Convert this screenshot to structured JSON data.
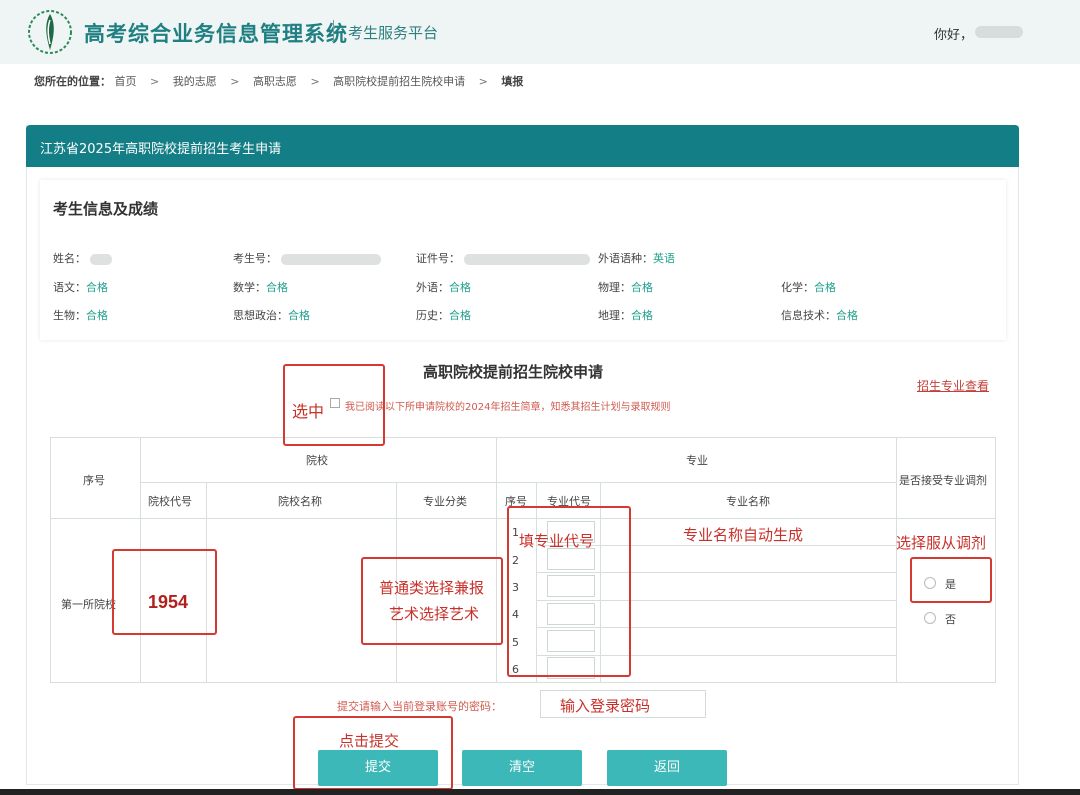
{
  "header": {
    "system_title": "高考综合业务信息管理系统",
    "platform": "考生服务平台",
    "greeting": "你好，"
  },
  "breadcrumb": {
    "prefix": "您所在的位置：",
    "items": [
      "首页",
      "我的志愿",
      "高职志愿",
      "高职院校提前招生院校申请"
    ],
    "current": "填报"
  },
  "panel": {
    "title": "江苏省2025年高职院校提前招生考生申请"
  },
  "info": {
    "title": "考生信息及成绩",
    "name_label": "姓名：",
    "exam_no_label": "考生号：",
    "id_label": "证件号：",
    "lang_label": "外语语种：",
    "lang_value": "英语",
    "grades": [
      {
        "label": "语文：",
        "value": "合格"
      },
      {
        "label": "数学：",
        "value": "合格"
      },
      {
        "label": "外语：",
        "value": "合格"
      },
      {
        "label": "物理：",
        "value": "合格"
      },
      {
        "label": "化学：",
        "value": "合格"
      },
      {
        "label": "生物：",
        "value": "合格"
      },
      {
        "label": "思想政治：",
        "value": "合格"
      },
      {
        "label": "历史：",
        "value": "合格"
      },
      {
        "label": "地理：",
        "value": "合格"
      },
      {
        "label": "信息技术：",
        "value": "合格"
      }
    ]
  },
  "form": {
    "title": "高职院校提前招生院校申请",
    "major_link": "招生专业查看",
    "agree_text": "我已阅读以下所申请院校的2024年招生简章，知悉其招生计划与录取规则",
    "table": {
      "col_index": "序号",
      "group_school": "院校",
      "col_school_code": "院校代号",
      "col_school_name": "院校名称",
      "col_category": "专业分类",
      "group_major": "专业",
      "col_major_index": "序号",
      "col_major_code": "专业代号",
      "col_major_name": "专业名称",
      "col_adjust": "是否接受专业调剂",
      "row_label": "第一所院校",
      "school_code": "1954",
      "major_rows": [
        "1",
        "2",
        "3",
        "4",
        "5",
        "6"
      ],
      "adjust_yes": "是",
      "adjust_no": "否"
    },
    "password_label": "提交请输入当前登录账号的密码："
  },
  "buttons": {
    "submit": "提交",
    "clear": "清空",
    "back": "返回"
  },
  "annotations": {
    "select": "选中",
    "fill_code": "填专业代号",
    "auto_name": "专业名称自动生成",
    "choose_adjust": "选择服从调剂",
    "category_line1": "普通类选择兼报",
    "category_line2": "艺术选择艺术",
    "enter_password": "输入登录密码",
    "click_submit": "点击提交"
  },
  "colors": {
    "teal": "#147e86",
    "button": "#3db8b8",
    "annotation_red": "#c8312a",
    "pass_green": "#20a08c"
  }
}
